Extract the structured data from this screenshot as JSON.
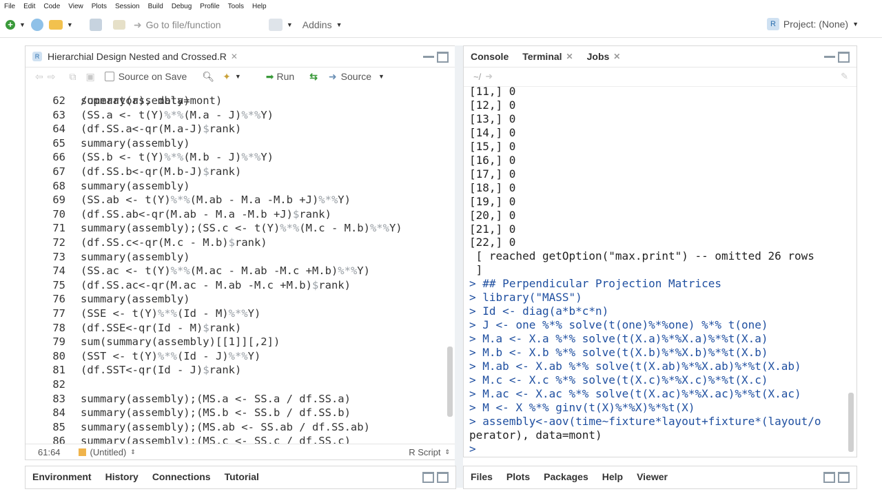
{
  "menu": [
    "File",
    "Edit",
    "Code",
    "View",
    "Plots",
    "Session",
    "Build",
    "Debug",
    "Profile",
    "Tools",
    "Help"
  ],
  "toolbar": {
    "goto_placeholder": "Go to file/function",
    "addins_label": "Addins",
    "project_label": "Project: (None)"
  },
  "editor": {
    "tab_title": "Hierarchial Design Nested and Crossed.R",
    "source_on_save": "Source on Save",
    "run_label": "Run",
    "source_label": "Source",
    "partial_line": "/operator), data=mont)",
    "lines": [
      {
        "n": "62",
        "code": "summary(assembly)"
      },
      {
        "n": "63",
        "code": "(SS.a <- t(Y)%*%(M.a - J)%*%Y)"
      },
      {
        "n": "64",
        "code": "(df.SS.a<-qr(M.a-J)$rank)"
      },
      {
        "n": "65",
        "code": "summary(assembly)"
      },
      {
        "n": "66",
        "code": "(SS.b <- t(Y)%*%(M.b - J)%*%Y)"
      },
      {
        "n": "67",
        "code": "(df.SS.b<-qr(M.b-J)$rank)"
      },
      {
        "n": "68",
        "code": "summary(assembly)"
      },
      {
        "n": "69",
        "code": "(SS.ab <- t(Y)%*%(M.ab - M.a -M.b +J)%*%Y)"
      },
      {
        "n": "70",
        "code": "(df.SS.ab<-qr(M.ab - M.a -M.b +J)$rank)"
      },
      {
        "n": "71",
        "code": "summary(assembly);(SS.c <- t(Y)%*%(M.c - M.b)%*%Y)"
      },
      {
        "n": "72",
        "code": "(df.SS.c<-qr(M.c - M.b)$rank)"
      },
      {
        "n": "73",
        "code": "summary(assembly)"
      },
      {
        "n": "74",
        "code": "(SS.ac <- t(Y)%*%(M.ac - M.ab -M.c +M.b)%*%Y)"
      },
      {
        "n": "75",
        "code": "(df.SS.ac<-qr(M.ac - M.ab -M.c +M.b)$rank)"
      },
      {
        "n": "76",
        "code": "summary(assembly)"
      },
      {
        "n": "77",
        "code": "(SSE <- t(Y)%*%(Id - M)%*%Y)"
      },
      {
        "n": "78",
        "code": "(df.SSE<-qr(Id - M)$rank)"
      },
      {
        "n": "79",
        "code": "sum(summary(assembly)[[1]][,2])"
      },
      {
        "n": "80",
        "code": "(SST <- t(Y)%*%(Id - J)%*%Y)"
      },
      {
        "n": "81",
        "code": "(df.SST<-qr(Id - J)$rank)"
      },
      {
        "n": "82",
        "code": ""
      },
      {
        "n": "83",
        "code": "summary(assembly);(MS.a <- SS.a / df.SS.a)"
      },
      {
        "n": "84",
        "code": "summary(assembly);(MS.b <- SS.b / df.SS.b)"
      },
      {
        "n": "85",
        "code": "summary(assembly);(MS.ab <- SS.ab / df.SS.ab)"
      },
      {
        "n": "86",
        "code": "summary(assembly);(MS.c <- SS.c / df.SS.c)"
      }
    ],
    "status_pos": "61:64",
    "status_scope": "(Untitled)",
    "status_type": "R Script"
  },
  "console": {
    "tabs": [
      "Console",
      "Terminal",
      "Jobs"
    ],
    "path": "~/",
    "lines": [
      {
        "p": "",
        "t": "[11,] 0"
      },
      {
        "p": "",
        "t": "[12,] 0"
      },
      {
        "p": "",
        "t": "[13,] 0"
      },
      {
        "p": "",
        "t": "[14,] 0"
      },
      {
        "p": "",
        "t": "[15,] 0"
      },
      {
        "p": "",
        "t": "[16,] 0"
      },
      {
        "p": "",
        "t": "[17,] 0"
      },
      {
        "p": "",
        "t": "[18,] 0"
      },
      {
        "p": "",
        "t": "[19,] 0"
      },
      {
        "p": "",
        "t": "[20,] 0"
      },
      {
        "p": "",
        "t": "[21,] 0"
      },
      {
        "p": "",
        "t": "[22,] 0"
      },
      {
        "p": "",
        "t": " [ reached getOption(\"max.print\") -- omitted 26 rows"
      },
      {
        "p": "",
        "t": " ]"
      },
      {
        "p": ">",
        "t": "## Perpendicular Projection Matrices"
      },
      {
        "p": ">",
        "t": "library(\"MASS\")"
      },
      {
        "p": ">",
        "t": "Id <- diag(a*b*c*n)"
      },
      {
        "p": ">",
        "t": "J <- one %*% solve(t(one)%*%one) %*% t(one)"
      },
      {
        "p": ">",
        "t": "M.a <- X.a %*% solve(t(X.a)%*%X.a)%*%t(X.a)"
      },
      {
        "p": ">",
        "t": "M.b <- X.b %*% solve(t(X.b)%*%X.b)%*%t(X.b)"
      },
      {
        "p": ">",
        "t": "M.ab <- X.ab %*% solve(t(X.ab)%*%X.ab)%*%t(X.ab)"
      },
      {
        "p": ">",
        "t": "M.c <- X.c %*% solve(t(X.c)%*%X.c)%*%t(X.c)"
      },
      {
        "p": ">",
        "t": "M.ac <- X.ac %*% solve(t(X.ac)%*%X.ac)%*%t(X.ac)"
      },
      {
        "p": ">",
        "t": "M <- X %*% ginv(t(X)%*%X)%*%t(X)"
      },
      {
        "p": ">",
        "t": "assembly<-aov(time~fixture*layout+fixture*(layout/o"
      },
      {
        "p": "",
        "t": "perator), data=mont)"
      },
      {
        "p": ">",
        "t": ""
      }
    ]
  },
  "bottom_left_tabs": [
    "Environment",
    "History",
    "Connections",
    "Tutorial"
  ],
  "bottom_right_tabs": [
    "Files",
    "Plots",
    "Packages",
    "Help",
    "Viewer"
  ],
  "colors": {
    "prompt": "#1f4fa0",
    "code_text": "#333333",
    "operator": "#9aa0a6",
    "run_green": "#3a9a3a",
    "accent_blue": "#2c6fae"
  }
}
